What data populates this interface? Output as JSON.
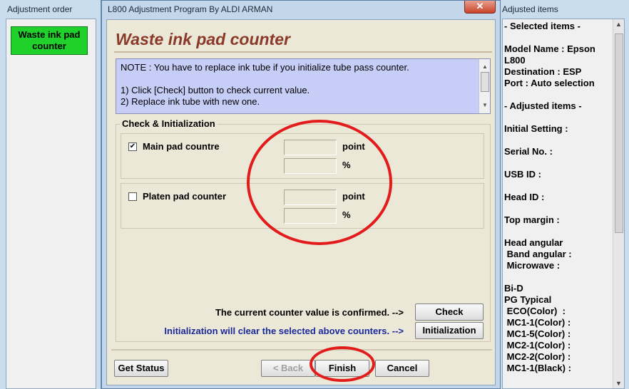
{
  "left_window": {
    "title": "Adjustment order",
    "button_label": "Waste ink pad counter"
  },
  "right_window": {
    "title": "Adjusted items",
    "lines": [
      "- Selected items -",
      "",
      "Model Name : Epson",
      "L800",
      "Destination : ESP",
      "Port : Auto selection",
      "",
      "- Adjusted items -",
      "",
      "Initial Setting :",
      "",
      "Serial No. :",
      "",
      "USB ID :",
      "",
      "Head ID :",
      "",
      "Top margin :",
      "",
      "Head angular",
      " Band angular :",
      " Microwave :",
      "",
      "Bi-D",
      "PG Typical",
      " ECO(Color)  :",
      " MC1-1(Color) :",
      " MC1-5(Color) :",
      " MC2-1(Color) :",
      " MC2-2(Color) :",
      " MC1-1(Black) :"
    ]
  },
  "dialog": {
    "title": "L800 Adjustment Program By ALDI ARMAN",
    "close_glyph": "✕",
    "heading": "Waste ink pad counter",
    "note": {
      "line1": "NOTE : You have to replace ink tube if you initialize tube pass counter.",
      "line2": "1) Click [Check] button to check current value.",
      "line3": "2) Replace ink tube with new one."
    },
    "group_title": "Check & Initialization",
    "main_pad": {
      "label": "Main pad countre",
      "checked": true,
      "check_glyph": "✔",
      "unit_point": "point",
      "unit_percent": "%",
      "point_value": "",
      "percent_value": ""
    },
    "platen_pad": {
      "label": "Platen pad counter",
      "checked": false,
      "unit_point": "point",
      "unit_percent": "%",
      "point_value": "",
      "percent_value": ""
    },
    "confirm_text": "The current counter value is confirmed. -->",
    "init_text": "Initialization will clear the selected above counters. -->",
    "buttons": {
      "check": "Check",
      "initialization": "Initialization",
      "get_status": "Get Status",
      "back": "< Back",
      "finish": "Finish",
      "cancel": "Cancel"
    }
  },
  "colors": {
    "heading": "#8b3a2a",
    "note_bg": "#c6cdf6",
    "init_text": "#1a2a9a",
    "waste_button": "#1fd12a",
    "annotation": "#e21b1b"
  }
}
